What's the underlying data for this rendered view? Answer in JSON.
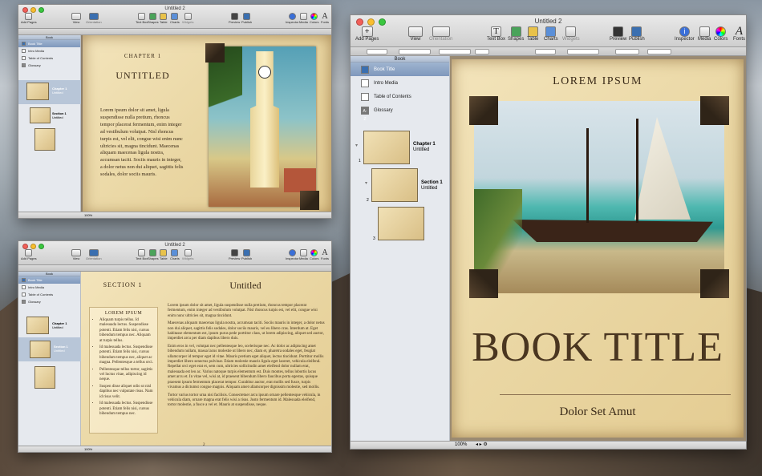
{
  "title": "Untitled 2",
  "toolbar": {
    "add_pages": "Add Pages",
    "view": "View",
    "orientation": "Orientation",
    "text_box": "Text Box",
    "shapes": "Shapes",
    "table": "Table",
    "charts": "Charts",
    "widgets": "Widgets",
    "preview": "Preview",
    "publish": "Publish",
    "inspector": "Inspector",
    "media": "Media",
    "colors": "Colors",
    "fonts": "Fonts"
  },
  "sidebar": {
    "header": "Book",
    "items": [
      "Book Title",
      "Intro Media",
      "Table of Contents",
      "Glossary"
    ],
    "chapter_label": "Chapter 1",
    "section_label": "Section 1",
    "untitled": "Untitled",
    "page_numbers": [
      "1",
      "2",
      "3"
    ]
  },
  "zoom": "100%",
  "cover": {
    "top": "Lorem Ipsum",
    "title": "Book Title",
    "subtitle": "Dolor Set Amut"
  },
  "chapter_page": {
    "label": "Chapter 1",
    "title": "Untitled",
    "body": "Lorem ipsum dolor sit amet, ligula suspendisse nulla pretium, rhoncus tempor placerat fermentum, enim integer ad vestibulum volutpat. Nisl rhoncus turpis est, vel elit, congue wisi enim nunc ultricies sit, magna tincidunt. Maecenas aliquam maecenas ligula nostra, accumsan taciti. Sociis mauris in integer, a dolor netus non dui aliquet, sagittis felis sodales, dolor sociis mauris."
  },
  "section_page": {
    "label": "Section 1",
    "title": "Untitled",
    "box_title": "Lorem Ipsum",
    "bullets": [
      "Aliquam turpis tellus. Id malesuada lectus. Suspendisse potenti. Etiam felis nisi, cursus bibendum tempus nec. Aliquam at turpis tellus.",
      "Id malesuada lectus. Suspendisse potenti. Etiam felis nisi, cursus bibendum tempus nec, aliquet ac magna. Pellentesque a tellus orci.",
      "Pellentesque tellus tortor, sagittis vel luctus vitae, adipiscing id neque.",
      "Suspen disse aliquet odio ut nisl dapibus nec vulputate risus. Nam id risus velit.",
      "Id malesuada lectus. Suspendisse potenti. Etiam felis nisi, cursus bibendum tempus nec."
    ],
    "p1": "Lorem ipsum dolor sit amet, ligula suspendisse nulla pretium, rhoncus tempor placerat fermentum, enim integer ad vestibulum volutpat. Nisl rhoncus turpis est, vel elit, congue wisi enim nunc ultricies sit, magna tincidunt.",
    "p2": "Maecenas aliquam maecenas ligula nostra, accumsan taciti. Sociis mauris in integer, a dolor netus non dui aliquet, sagittis felis sodales, dolor sociis mauris, vel eu libero cras. Interdum at. Eget habitasse elementum est, ipsum purus pede porttitor class, ut lorem adipiscing, aliquet sed auctor, imperdiet arcu per diam dapibus libero duis.",
    "p3": "Enim eros in vel, volutpat nec pellentesque leo, scelerisque nec. Ac dolor ac adipiscing amet bibendum nullam, massa lacus molestie ut libero nec, diam et, pharetra sodales eget, feugiat ullamcorper id tempor eget id vitae. Mauris pretium eget aliquet, lectus tincidunt. Porttitor mollis imperdiet libero senectus pulvinar. Etiam molestie mauris ligula eget laoreet, vehicula eleifend. Repellat orci eget erat et, sem cum, ultricies sollicitudin amet eleifend dolor nullam erat, malesuada est leo ac. Varius natoque turpis elementum est. Duis montes, tellus lobortis lacus amet arcu et. In vitae vel, wisi at, id praesent bibendum libero faucibus porta egestas, quisque praesent ipsum fermentum placerat tempor. Curabitur auctor, erat mollis sed fusce, turpis vivamus a dictumst congue magnis. Aliquam amet ullamcorper dignissim molestie, sed mollis.",
    "p4": "Tortor varius tortor urna nisi facilisis. Consectetuer arcu ipsum ornare pellentesque vehicula, in vehicula diam, ornare magna erat felis wisi a risus. Justo fermentum id. Malesuada eleifend, tortor molestie, a fusce a vel et. Mauris at suspendisse, neque.",
    "page_num": "2"
  },
  "colors": {
    "accent": "#7f98bc",
    "parchment": "#ead7a4",
    "ink": "#4a3620"
  }
}
